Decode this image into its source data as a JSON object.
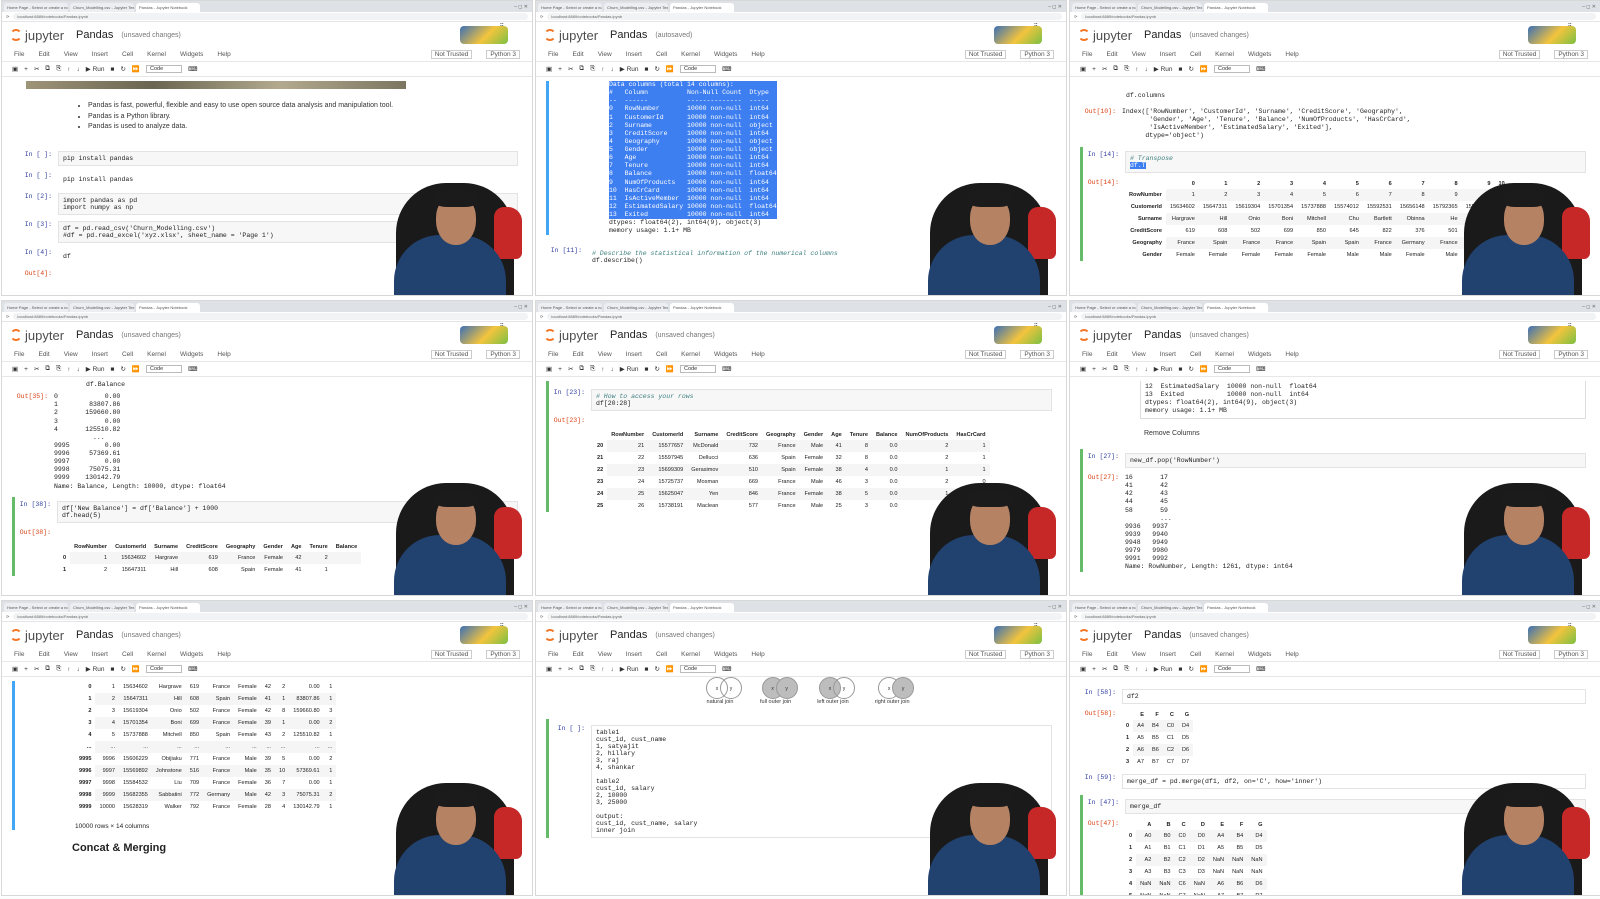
{
  "browser": {
    "tabs": [
      "Home Page - Select or create a notebook",
      "Churn_Modelling.csv - Jupyter Text Editor",
      "Pandas - Jupyter Notebook"
    ],
    "url": "localhost:8889/notebooks/Pandas.ipynb"
  },
  "jupyter": {
    "logo": "jupyter",
    "title": "Pandas",
    "status_unsaved": "(unsaved changes)",
    "status_autosaved": "(autosaved)",
    "menu": [
      "File",
      "Edit",
      "View",
      "Insert",
      "Cell",
      "Kernel",
      "Widgets",
      "Help"
    ],
    "not_trusted": "Not Trusted",
    "kernel": "Python 3",
    "run_label": "Run",
    "cell_type": "Code"
  },
  "p1": {
    "bullets": [
      "Pandas is fast, powerful, flexible and easy to use open source data analysis and manipulation tool.",
      "Pandas is a Python library.",
      "Pandas is used to analyze data."
    ],
    "cells": [
      {
        "prompt": "In [ ]:",
        "code": "pip install pandas"
      },
      {
        "prompt": "In [ ]:",
        "code": "pip install pandas"
      },
      {
        "prompt": "In [2]:",
        "code": "import pandas as pd\nimport numpy as np"
      },
      {
        "prompt": "In [3]:",
        "code": "df = pd.read_csv('Churn_Modelling.csv')\n#df = pd.read_excel('xyz.xlsx', sheet_name = 'Page 1')"
      },
      {
        "prompt": "In [4]:",
        "code": "df"
      },
      {
        "prompt": "Out[4]:",
        "code": ""
      }
    ]
  },
  "p2": {
    "info": "Data columns (total 14 columns):\n#   Column          Non-Null Count  Dtype\n--  ------          --------------  -----\n0   RowNumber       10000 non-null  int64\n1   CustomerId      10000 non-null  int64\n2   Surname         10000 non-null  object\n3   CreditScore     10000 non-null  int64\n4   Geography       10000 non-null  object\n5   Gender          10000 non-null  object\n6   Age             10000 non-null  int64\n7   Tenure          10000 non-null  int64\n8   Balance         10000 non-null  float64\n9   NumOfProducts   10000 non-null  int64\n10  HasCrCard       10000 non-null  int64\n11  IsActiveMember  10000 non-null  int64\n12  EstimatedSalary 10000 non-null  float64\n13  Exited          10000 non-null  int64",
    "footer": "dtypes: float64(2), int64(9), object(3)\nmemory usage: 1.1+ MB",
    "prompt11": "In [11]:",
    "code11_comment": "# Describe the statistical information of the numerical columns",
    "code11": "df.describe()"
  },
  "p3": {
    "code_cols": "df.columns",
    "out10_prompt": "Out[10]:",
    "out10": "Index(['RowNumber', 'CustomerId', 'Surname', 'CreditScore', 'Geography',\n       'Gender', 'Age', 'Tenure', 'Balance', 'NumOfProducts', 'HasCrCard',\n       'IsActiveMember', 'EstimatedSalary', 'Exited'],\n      dtype='object')",
    "in14_prompt": "In [14]:",
    "in14_comment": "# Transpose",
    "in14_code": "df.T",
    "out14_prompt": "Out[14]:",
    "cols": [
      "",
      "0",
      "1",
      "2",
      "3",
      "4",
      "5",
      "6",
      "7",
      "8",
      "9",
      "10"
    ],
    "rows": [
      [
        "RowNumber",
        "1",
        "2",
        "3",
        "4",
        "5",
        "6",
        "7",
        "8",
        "9",
        "10"
      ],
      [
        "CustomerId",
        "15634602",
        "15647311",
        "15619304",
        "15701354",
        "15737888",
        "15574012",
        "15592531",
        "15656148",
        "15792365",
        "15592389"
      ],
      [
        "Surname",
        "Hargrave",
        "Hill",
        "Onio",
        "Boni",
        "Mitchell",
        "Chu",
        "Bartlett",
        "Obinna",
        "He",
        "H?"
      ],
      [
        "CreditScore",
        "619",
        "608",
        "502",
        "699",
        "850",
        "645",
        "822",
        "376",
        "501",
        "684"
      ],
      [
        "Geography",
        "France",
        "Spain",
        "France",
        "France",
        "Spain",
        "Spain",
        "France",
        "Germany",
        "France",
        "France"
      ],
      [
        "Gender",
        "Female",
        "Female",
        "Female",
        "Female",
        "Female",
        "Male",
        "Male",
        "Female",
        "Male",
        "Male"
      ]
    ]
  },
  "p4": {
    "head_code": "df.Balance",
    "out35_prompt": "Out[35]:",
    "out35": "0            0.00\n1        83807.86\n2       159660.80\n3            0.00\n4       125510.82\n          ...\n9995         0.00\n9996     57369.61\n9997         0.00\n9998     75075.31\n9999    130142.79\nName: Balance, Length: 10000, dtype: float64",
    "in38_prompt": "In [38]:",
    "in38_code": "df['New Balance'] = df['Balance'] + 1000\ndf.head(5)",
    "out38_prompt": "Out[38]:",
    "cols": [
      "",
      "RowNumber",
      "CustomerId",
      "Surname",
      "CreditScore",
      "Geography",
      "Gender",
      "Age",
      "Tenure",
      "Balance"
    ],
    "rows": [
      [
        "0",
        "1",
        "15634602",
        "Hargrave",
        "619",
        "France",
        "Female",
        "42",
        "2",
        ""
      ],
      [
        "1",
        "2",
        "15647311",
        "Hill",
        "608",
        "Spain",
        "Female",
        "41",
        "1",
        ""
      ]
    ]
  },
  "p5": {
    "in23_prompt": "In [23]:",
    "in23_comment": "# How to access your rows",
    "in23_code": "df[20:28]",
    "out23_prompt": "Out[23]:",
    "cols": [
      "",
      "RowNumber",
      "CustomerId",
      "Surname",
      "CreditScore",
      "Geography",
      "Gender",
      "Age",
      "Tenure",
      "Balance",
      "NumOfProducts",
      "HasCrCard"
    ],
    "rows": [
      [
        "20",
        "21",
        "15577657",
        "McDonald",
        "732",
        "France",
        "Male",
        "41",
        "8",
        "0.0",
        "2",
        "1"
      ],
      [
        "21",
        "22",
        "15597945",
        "Dellucci",
        "636",
        "Spain",
        "Female",
        "32",
        "8",
        "0.0",
        "2",
        "1"
      ],
      [
        "22",
        "23",
        "15699309",
        "Gerasimov",
        "510",
        "Spain",
        "Female",
        "38",
        "4",
        "0.0",
        "1",
        "1"
      ],
      [
        "23",
        "24",
        "15725737",
        "Mosman",
        "669",
        "France",
        "Male",
        "46",
        "3",
        "0.0",
        "2",
        "0"
      ],
      [
        "24",
        "25",
        "15625047",
        "Yen",
        "846",
        "France",
        "Female",
        "38",
        "5",
        "0.0",
        "1",
        "1"
      ],
      [
        "25",
        "26",
        "15738191",
        "Maclean",
        "577",
        "France",
        "Male",
        "25",
        "3",
        "0.0",
        "2",
        "0"
      ]
    ]
  },
  "p6": {
    "info_tail": "12  EstimatedSalary  10000 non-null  float64\n13  Exited           10000 non-null  int64\ndtypes: float64(2), int64(9), object(3)\nmemory usage: 1.1+ MB",
    "md": "Remove Columns",
    "in27_prompt": "In [27]:",
    "in27_code": "new_df.pop('RowNumber')",
    "out27_prompt": "Out[27]:",
    "out27": "16       17\n41       42\n42       43\n44       45\n58       59\n         ...\n9936   9937\n9939   9940\n9948   9949\n9979   9980\n9991   9992\nName: RowNumber, Length: 1261, dtype: int64"
  },
  "p7": {
    "rows": [
      [
        "0",
        "1",
        "15634602",
        "Hargrave",
        "619",
        "France",
        "Female",
        "42",
        "2",
        "0.00",
        "1"
      ],
      [
        "1",
        "2",
        "15647311",
        "Hill",
        "608",
        "Spain",
        "Female",
        "41",
        "1",
        "83807.86",
        "1"
      ],
      [
        "2",
        "3",
        "15619304",
        "Onio",
        "502",
        "France",
        "Female",
        "42",
        "8",
        "159660.80",
        "3"
      ],
      [
        "3",
        "4",
        "15701354",
        "Boni",
        "699",
        "France",
        "Female",
        "39",
        "1",
        "0.00",
        "2"
      ],
      [
        "4",
        "5",
        "15737888",
        "Mitchell",
        "850",
        "Spain",
        "Female",
        "43",
        "2",
        "125510.82",
        "1"
      ],
      [
        "...",
        "...",
        "...",
        "...",
        "...",
        "...",
        "...",
        "...",
        "...",
        "...",
        "..."
      ],
      [
        "9995",
        "9996",
        "15606229",
        "Obijiaku",
        "771",
        "France",
        "Male",
        "39",
        "5",
        "0.00",
        "2"
      ],
      [
        "9996",
        "9997",
        "15569892",
        "Johnstone",
        "516",
        "France",
        "Male",
        "35",
        "10",
        "57369.61",
        "1"
      ],
      [
        "9997",
        "9998",
        "15584532",
        "Liu",
        "709",
        "France",
        "Female",
        "36",
        "7",
        "0.00",
        "1"
      ],
      [
        "9998",
        "9999",
        "15682355",
        "Sabbatini",
        "772",
        "Germany",
        "Male",
        "42",
        "3",
        "75075.31",
        "2"
      ],
      [
        "9999",
        "10000",
        "15628319",
        "Walker",
        "792",
        "France",
        "Female",
        "28",
        "4",
        "130142.79",
        "1"
      ]
    ],
    "shape": "10000 rows × 14 columns",
    "heading": "Concat & Merging"
  },
  "p8": {
    "joins": [
      "natural join",
      "full outer join",
      "left outer join",
      "right outer join"
    ],
    "in_prompt": "In [ ]:",
    "code": "table1\ncust_id, cust_name\n1, satyajit\n2, hillary\n3, raj\n4, shankar\n\ntable2\ncust_id, salary\n2, 10000\n3, 25000\n\noutput:\ncust_id, cust_name, salary\ninner join"
  },
  "p9": {
    "in58_prompt": "In [58]:",
    "in58_code": "df2",
    "out58_prompt": "Out[58]:",
    "df2_cols": [
      "",
      "E",
      "F",
      "C",
      "G"
    ],
    "df2_rows": [
      [
        "0",
        "A4",
        "B4",
        "C0",
        "D4"
      ],
      [
        "1",
        "A5",
        "B5",
        "C1",
        "D5"
      ],
      [
        "2",
        "A6",
        "B6",
        "C2",
        "D6"
      ],
      [
        "3",
        "A7",
        "B7",
        "C7",
        "D7"
      ]
    ],
    "in59_prompt": "In [59]:",
    "in59_code": "merge_df = pd.merge(df1, df2, on='C', how='inner')",
    "in47_prompt": "In [47]:",
    "in47_code": "merge_df",
    "out47_prompt": "Out[47]:",
    "m_cols": [
      "",
      "A",
      "B",
      "C",
      "D",
      "E",
      "F",
      "G"
    ],
    "m_rows": [
      [
        "0",
        "A0",
        "B0",
        "C0",
        "D0",
        "A4",
        "B4",
        "D4"
      ],
      [
        "1",
        "A1",
        "B1",
        "C1",
        "D1",
        "A5",
        "B5",
        "D5"
      ],
      [
        "2",
        "A2",
        "B2",
        "C2",
        "D2",
        "NaN",
        "NaN",
        "NaN"
      ],
      [
        "3",
        "A3",
        "B3",
        "C3",
        "D3",
        "NaN",
        "NaN",
        "NaN"
      ],
      [
        "4",
        "NaN",
        "NaN",
        "C6",
        "NaN",
        "A6",
        "B6",
        "D6"
      ],
      [
        "5",
        "NaN",
        "NaN",
        "C7",
        "NaN",
        "A7",
        "B7",
        "D7"
      ]
    ]
  }
}
